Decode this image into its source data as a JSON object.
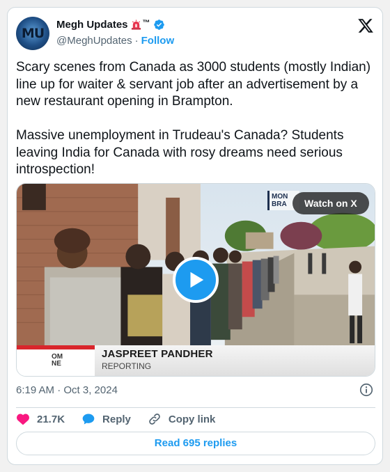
{
  "author": {
    "display_name": "Megh Updates",
    "avatar_text": "MU",
    "tm": "™",
    "handle": "@MeghUpdates",
    "separator": "·",
    "follow_label": "Follow"
  },
  "tweet": {
    "text": "Scary scenes from Canada as 3000 students (mostly Indian) line up for waiter & servant job after an advertisement by a new restaurant opening in Brampton.\n\nMassive unemployment in Trudeau's Canada? Students leaving India for Canada with rosy dreams need serious introspection!",
    "timestamp": "6:19 AM · Oct 3, 2024"
  },
  "media": {
    "watch_label": "Watch on X",
    "channel_logo_text": "MON\nBRA",
    "lower_third_logo": "OM\nNE",
    "lower_third_name": "JASPREET PANDHER",
    "lower_third_sub": "REPORTING"
  },
  "actions": {
    "like_count": "21.7K",
    "reply_label": "Reply",
    "copy_label": "Copy link"
  },
  "read_replies_label": "Read 695 replies",
  "colors": {
    "accent": "#1d9bf0",
    "text": "#0f1419",
    "muted": "#536471",
    "like": "#f91880",
    "border": "#cfd9de"
  }
}
